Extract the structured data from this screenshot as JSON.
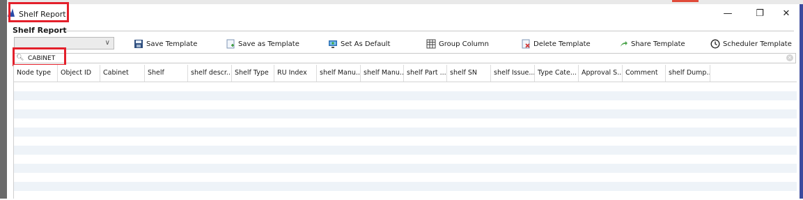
{
  "window": {
    "title": "Shelf Report",
    "minimize_glyph": "—",
    "maximize_glyph": "❐",
    "close_glyph": "✕",
    "accent_color": "#3c4a9e",
    "highlight_color": "#e3202b"
  },
  "panel": {
    "header": "Shelf Report"
  },
  "toolbar": {
    "template_select": {
      "value": ""
    },
    "buttons": [
      {
        "label": "Save Template",
        "icon": "save-template-icon"
      },
      {
        "label": "Save as Template",
        "icon": "save-as-template-icon"
      },
      {
        "label": "Set As Default",
        "icon": "set-default-icon"
      },
      {
        "label": "Group Column",
        "icon": "group-column-icon"
      },
      {
        "label": "Delete Template",
        "icon": "delete-template-icon"
      },
      {
        "label": "Share Template",
        "icon": "share-template-icon"
      },
      {
        "label": "Scheduler Template",
        "icon": "clock-icon"
      }
    ]
  },
  "search": {
    "value": "CABINET"
  },
  "table": {
    "columns": [
      "Node type",
      "Object ID",
      "Cabinet",
      "Shelf",
      "shelf descr...",
      "Shelf Type",
      "RU Index",
      "shelf Manu...",
      "shelf Manu...",
      "shelf Part ...",
      "shelf SN",
      "shelf Issue...",
      "Type Cate...",
      "Approval S...",
      "Comment",
      "shelf Dump..."
    ],
    "rows": []
  }
}
